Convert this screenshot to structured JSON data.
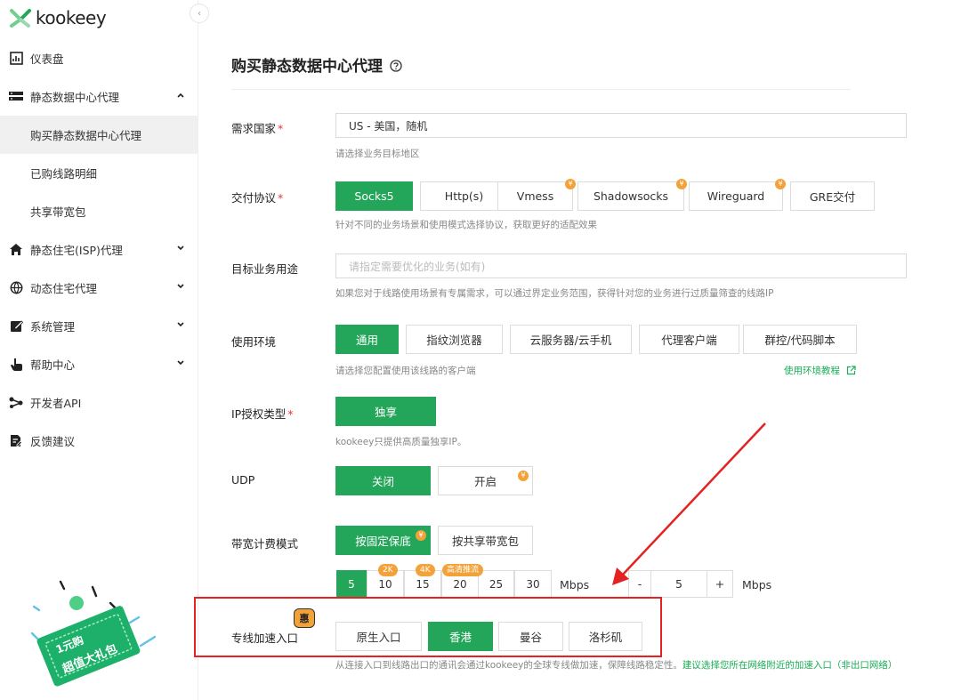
{
  "brand": {
    "name": "kookeey"
  },
  "sidebar": {
    "items": [
      {
        "label": "仪表盘",
        "icon": "dashboard-chart-icon",
        "expandable": false
      },
      {
        "label": "静态数据中心代理",
        "icon": "server-icon",
        "expandable": true,
        "expanded": true,
        "children": [
          {
            "label": "购买静态数据中心代理",
            "active": true
          },
          {
            "label": "已购线路明细",
            "active": false
          },
          {
            "label": "共享带宽包",
            "active": false
          }
        ]
      },
      {
        "label": "静态住宅(ISP)代理",
        "icon": "home-icon",
        "expandable": true
      },
      {
        "label": "动态住宅代理",
        "icon": "globe-icon",
        "expandable": true
      },
      {
        "label": "系统管理",
        "icon": "edit-icon",
        "expandable": true
      },
      {
        "label": "帮助中心",
        "icon": "hand-pointer-icon",
        "expandable": true
      },
      {
        "label": "开发者API",
        "icon": "share-nodes-icon",
        "expandable": false
      },
      {
        "label": "反馈建议",
        "icon": "feedback-doc-icon",
        "expandable": false
      }
    ],
    "promo": {
      "line1": "1元购",
      "line2": "超值大礼包"
    }
  },
  "page": {
    "title": "购买静态数据中心代理"
  },
  "form": {
    "country": {
      "label": "需求国家",
      "value": "US - 美国，随机",
      "hint": "请选择业务目标地区"
    },
    "protocol": {
      "label": "交付协议",
      "options": [
        "Socks5",
        "Http(s)",
        "Vmess",
        "Shadowsocks",
        "Wireguard",
        "GRE交付"
      ],
      "selected": "Socks5",
      "premium": [
        "Vmess",
        "Shadowsocks",
        "Wireguard"
      ],
      "hint": "针对不同的业务场景和使用模式选择协议，获取更好的适配效果"
    },
    "purpose": {
      "label": "目标业务用途",
      "placeholder": "请指定需要优化的业务(如有)",
      "hint": "如果您对于线路使用场景有专属需求，可以通过界定业务范围，获得针对您的业务进行过质量筛查的线路IP"
    },
    "environment": {
      "label": "使用环境",
      "options": [
        "通用",
        "指纹浏览器",
        "云服务器/云手机",
        "代理客户端",
        "群控/代码脚本"
      ],
      "selected": "通用",
      "hint": "请选择您配置使用该线路的客户端",
      "link": "使用环境教程"
    },
    "ip_auth": {
      "label": "IP授权类型",
      "options": [
        "独享"
      ],
      "selected": "独享",
      "hint": "kookeey只提供高质量独享IP。"
    },
    "udp": {
      "label": "UDP",
      "options": [
        "关闭",
        "开启"
      ],
      "selected": "关闭",
      "premium": [
        "开启"
      ]
    },
    "billing": {
      "label": "带宽计费模式",
      "options": [
        "按固定保底",
        "按共享带宽包"
      ],
      "selected": "按固定保底",
      "premium": [
        "按固定保底"
      ],
      "bandwidth_options": [
        "5",
        "10",
        "15",
        "20",
        "25",
        "30"
      ],
      "bandwidth_selected": "5",
      "tags": {
        "10": "2K",
        "15": "4K",
        "20": "高清推流"
      },
      "unit": "Mbps",
      "stepper": {
        "minus": "-",
        "value": "5",
        "plus": "+",
        "unit": "Mbps"
      }
    },
    "accel": {
      "label": "专线加速入口",
      "badge": "惠",
      "options": [
        "原生入口",
        "香港",
        "曼谷",
        "洛杉矶"
      ],
      "selected": "香港",
      "hint": "从连接入口到线路出口的通讯会通过kookeey的全球专线做加速，保障线路稳定性。",
      "hint_highlight": "建议选择您所在网络附近的加速入口（非出口网络）"
    }
  },
  "colors": {
    "accent": "#23a65a",
    "premium": "#f3a23a",
    "annotation": "#e52222"
  }
}
